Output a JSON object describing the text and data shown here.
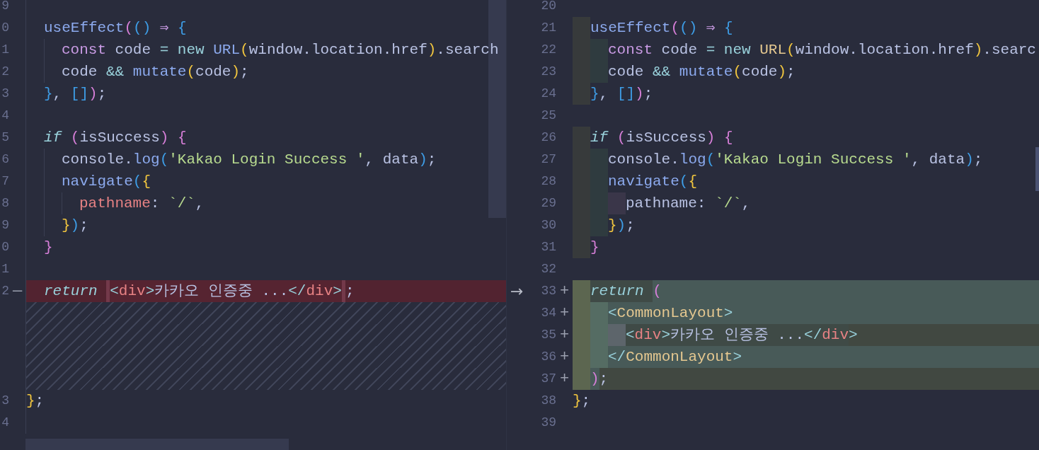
{
  "left_pane": {
    "lines": [
      {
        "number": "9"
      },
      {
        "number": "0",
        "indents": [
          {
            "highlight": false
          }
        ],
        "tokens": [
          {
            "kind": "fn",
            "text": "useEffect"
          },
          {
            "kind": "b1",
            "text": "("
          },
          {
            "kind": "b2",
            "text": "()"
          },
          {
            "kind": "kw",
            "text": " ⇒ "
          },
          {
            "kind": "b2",
            "text": "{"
          }
        ]
      },
      {
        "number": "1",
        "indents": [
          {
            "highlight": false
          },
          {
            "highlight": false
          }
        ],
        "tokens": [
          {
            "kind": "kw",
            "text": "const"
          },
          {
            "kind": "plain",
            "text": " code "
          },
          {
            "kind": "op",
            "text": "= new "
          },
          {
            "kind": "fn",
            "text": "URL"
          },
          {
            "kind": "b3",
            "text": "("
          },
          {
            "kind": "plain",
            "text": "window.location.href"
          },
          {
            "kind": "b3",
            "text": ")"
          },
          {
            "kind": "plain",
            "text": ".search"
          }
        ]
      },
      {
        "number": "2",
        "indents": [
          {
            "highlight": false
          },
          {
            "highlight": false
          }
        ],
        "tokens": [
          {
            "kind": "plain",
            "text": "code "
          },
          {
            "kind": "op",
            "text": "&& "
          },
          {
            "kind": "fn",
            "text": "mutate"
          },
          {
            "kind": "b3",
            "text": "("
          },
          {
            "kind": "plain",
            "text": "code"
          },
          {
            "kind": "b3",
            "text": ")"
          },
          {
            "kind": "plain",
            "text": ";"
          }
        ]
      },
      {
        "number": "3",
        "indents": [
          {
            "highlight": false
          }
        ],
        "tokens": [
          {
            "kind": "b2",
            "text": "}"
          },
          {
            "kind": "plain",
            "text": ", "
          },
          {
            "kind": "b2",
            "text": "[]"
          },
          {
            "kind": "b1",
            "text": ")"
          },
          {
            "kind": "plain",
            "text": ";"
          }
        ]
      },
      {
        "number": "4"
      },
      {
        "number": "5",
        "indents": [
          {
            "highlight": false
          }
        ],
        "tokens": [
          {
            "kind": "ital",
            "text": "if "
          },
          {
            "kind": "b1",
            "text": "("
          },
          {
            "kind": "plain",
            "text": "isSuccess"
          },
          {
            "kind": "b1",
            "text": ") {"
          }
        ]
      },
      {
        "number": "6",
        "indents": [
          {
            "highlight": false
          },
          {
            "highlight": false
          }
        ],
        "tokens": [
          {
            "kind": "plain",
            "text": "console."
          },
          {
            "kind": "fn",
            "text": "log"
          },
          {
            "kind": "b2",
            "text": "("
          },
          {
            "kind": "str",
            "text": "'Kakao Login Success '"
          },
          {
            "kind": "plain",
            "text": ", data"
          },
          {
            "kind": "b2",
            "text": ")"
          },
          {
            "kind": "plain",
            "text": ";"
          }
        ]
      },
      {
        "number": "7",
        "indents": [
          {
            "highlight": false
          },
          {
            "highlight": false
          }
        ],
        "tokens": [
          {
            "kind": "fn",
            "text": "navigate"
          },
          {
            "kind": "b2",
            "text": "("
          },
          {
            "kind": "b3",
            "text": "{"
          }
        ]
      },
      {
        "number": "8",
        "indents": [
          {
            "highlight": false
          },
          {
            "highlight": false
          },
          {
            "highlight": false
          }
        ],
        "tokens": [
          {
            "kind": "prop",
            "text": "pathname"
          },
          {
            "kind": "plain",
            "text": ": "
          },
          {
            "kind": "str",
            "text": "`/`"
          },
          {
            "kind": "plain",
            "text": ","
          }
        ]
      },
      {
        "number": "9",
        "indents": [
          {
            "highlight": false
          },
          {
            "highlight": false
          }
        ],
        "tokens": [
          {
            "kind": "b3",
            "text": "}"
          },
          {
            "kind": "b2",
            "text": ")"
          },
          {
            "kind": "plain",
            "text": ";"
          }
        ]
      },
      {
        "number": "0",
        "indents": [
          {
            "highlight": false
          }
        ],
        "tokens": [
          {
            "kind": "b1",
            "text": "}"
          }
        ]
      },
      {
        "number": "1"
      },
      {
        "number": "2",
        "removed": true,
        "marker": "—",
        "indents": [
          {
            "highlight": false
          }
        ],
        "tokens": [
          {
            "kind": "ital",
            "text": "return "
          },
          {
            "kind": "tagp",
            "text": "<",
            "emphasis": true
          },
          {
            "kind": "tag",
            "text": "div",
            "emphasis": true
          },
          {
            "kind": "tagp",
            "text": ">",
            "emphasis": true
          },
          {
            "kind": "plain",
            "text": "카카오 인증중 ...",
            "emphasis": true
          },
          {
            "kind": "tagp",
            "text": "</",
            "emphasis": true
          },
          {
            "kind": "tag",
            "text": "div",
            "emphasis": true
          },
          {
            "kind": "tagp",
            "text": ">",
            "emphasis": true
          },
          {
            "kind": "plain",
            "text": ";"
          }
        ]
      },
      {
        "kind": "spacer"
      },
      {
        "kind": "spacer"
      },
      {
        "kind": "spacer"
      },
      {
        "kind": "spacer"
      },
      {
        "number": "3",
        "tokens": [
          {
            "kind": "b3",
            "text": "}"
          },
          {
            "kind": "plain",
            "text": ";"
          }
        ]
      },
      {
        "number": "4"
      }
    ]
  },
  "right_pane": {
    "lines": [
      {
        "number": "20"
      },
      {
        "number": "21",
        "indents": [
          {
            "highlight": true
          }
        ],
        "tokens": [
          {
            "kind": "fn",
            "text": "useEffect"
          },
          {
            "kind": "b1",
            "text": "("
          },
          {
            "kind": "b2",
            "text": "()"
          },
          {
            "kind": "kw",
            "text": " ⇒ "
          },
          {
            "kind": "b2",
            "text": "{"
          }
        ]
      },
      {
        "number": "22",
        "indents": [
          {
            "highlight": true
          },
          {
            "highlight": true
          }
        ],
        "tokens": [
          {
            "kind": "kw",
            "text": "const"
          },
          {
            "kind": "plain",
            "text": " code "
          },
          {
            "kind": "op",
            "text": "= new "
          },
          {
            "kind": "comp",
            "text": "URL"
          },
          {
            "kind": "b3",
            "text": "("
          },
          {
            "kind": "plain",
            "text": "window.location.href"
          },
          {
            "kind": "b3",
            "text": ")"
          },
          {
            "kind": "plain",
            "text": ".searc"
          }
        ]
      },
      {
        "number": "23",
        "indents": [
          {
            "highlight": true
          },
          {
            "highlight": true
          }
        ],
        "tokens": [
          {
            "kind": "plain",
            "text": "code "
          },
          {
            "kind": "op",
            "text": "&& "
          },
          {
            "kind": "fn",
            "text": "mutate"
          },
          {
            "kind": "b3",
            "text": "("
          },
          {
            "kind": "plain",
            "text": "code"
          },
          {
            "kind": "b3",
            "text": ")"
          },
          {
            "kind": "plain",
            "text": ";"
          }
        ]
      },
      {
        "number": "24",
        "indents": [
          {
            "highlight": true
          }
        ],
        "tokens": [
          {
            "kind": "b2",
            "text": "}"
          },
          {
            "kind": "plain",
            "text": ", "
          },
          {
            "kind": "b2",
            "text": "[]"
          },
          {
            "kind": "b1",
            "text": ")"
          },
          {
            "kind": "plain",
            "text": ";"
          }
        ]
      },
      {
        "number": "25"
      },
      {
        "number": "26",
        "indents": [
          {
            "highlight": true
          }
        ],
        "tokens": [
          {
            "kind": "ital",
            "text": "if "
          },
          {
            "kind": "b1",
            "text": "("
          },
          {
            "kind": "plain",
            "text": "isSuccess"
          },
          {
            "kind": "b1",
            "text": ") {"
          }
        ]
      },
      {
        "number": "27",
        "indents": [
          {
            "highlight": true
          },
          {
            "highlight": true
          }
        ],
        "tokens": [
          {
            "kind": "plain",
            "text": "console."
          },
          {
            "kind": "fn",
            "text": "log"
          },
          {
            "kind": "b2",
            "text": "("
          },
          {
            "kind": "str",
            "text": "'Kakao Login Success '"
          },
          {
            "kind": "plain",
            "text": ", data"
          },
          {
            "kind": "b2",
            "text": ")"
          },
          {
            "kind": "plain",
            "text": ";"
          }
        ]
      },
      {
        "number": "28",
        "indents": [
          {
            "highlight": true
          },
          {
            "highlight": true
          }
        ],
        "tokens": [
          {
            "kind": "fn",
            "text": "navigate"
          },
          {
            "kind": "b2",
            "text": "("
          },
          {
            "kind": "b3",
            "text": "{"
          }
        ]
      },
      {
        "number": "29",
        "indents": [
          {
            "highlight": true
          },
          {
            "highlight": true
          },
          {
            "highlight": true
          }
        ],
        "tokens": [
          {
            "kind": "plain",
            "text": "pathname: "
          },
          {
            "kind": "str",
            "text": "`/`"
          },
          {
            "kind": "plain",
            "text": ","
          }
        ]
      },
      {
        "number": "30",
        "indents": [
          {
            "highlight": true
          },
          {
            "highlight": true
          }
        ],
        "tokens": [
          {
            "kind": "b3",
            "text": "}"
          },
          {
            "kind": "b2",
            "text": ")"
          },
          {
            "kind": "plain",
            "text": ";"
          }
        ]
      },
      {
        "number": "31",
        "indents": [
          {
            "highlight": true
          }
        ],
        "tokens": [
          {
            "kind": "b1",
            "text": "}"
          }
        ]
      },
      {
        "number": "32"
      },
      {
        "number": "33",
        "added": true,
        "marker": "+",
        "arrow": "→",
        "indents": [
          {
            "highlight": true
          }
        ],
        "tokens": [
          {
            "kind": "ital",
            "text": "return ",
            "emphasis": true
          },
          {
            "kind": "b1",
            "text": "("
          }
        ]
      },
      {
        "number": "34",
        "added": true,
        "marker": "+",
        "indents": [
          {
            "highlight": true
          },
          {
            "highlight": true
          }
        ],
        "tokens": [
          {
            "kind": "tagp",
            "text": "<"
          },
          {
            "kind": "comp",
            "text": "CommonLayout"
          },
          {
            "kind": "tagp",
            "text": ">"
          }
        ]
      },
      {
        "number": "35",
        "added": true,
        "marker": "+",
        "indents": [
          {
            "highlight": true
          },
          {
            "highlight": true
          },
          {
            "highlight": true
          }
        ],
        "tokens": [
          {
            "kind": "tagp",
            "text": "<",
            "emphasis": true
          },
          {
            "kind": "tag",
            "text": "div",
            "emphasis": true
          },
          {
            "kind": "tagp",
            "text": ">",
            "emphasis": true
          },
          {
            "kind": "plain",
            "text": "카카오 인증중 ...",
            "emphasis": true
          },
          {
            "kind": "tagp",
            "text": "</",
            "emphasis": true
          },
          {
            "kind": "tag",
            "text": "div",
            "emphasis": true
          },
          {
            "kind": "tagp",
            "text": ">",
            "emphasis": true
          }
        ]
      },
      {
        "number": "36",
        "added": true,
        "marker": "+",
        "indents": [
          {
            "highlight": true
          },
          {
            "highlight": true
          }
        ],
        "tokens": [
          {
            "kind": "tagp",
            "text": "</"
          },
          {
            "kind": "comp",
            "text": "CommonLayout"
          },
          {
            "kind": "tagp",
            "text": ">"
          }
        ]
      },
      {
        "number": "37",
        "added": true,
        "marker": "+",
        "indents": [
          {
            "highlight": true
          }
        ],
        "tokens": [
          {
            "kind": "b1",
            "text": ")"
          },
          {
            "kind": "plain",
            "text": ";",
            "emphasis": true
          }
        ]
      },
      {
        "number": "38",
        "tokens": [
          {
            "kind": "b3",
            "text": "}"
          },
          {
            "kind": "plain",
            "text": ";"
          }
        ]
      },
      {
        "number": "39"
      }
    ]
  }
}
